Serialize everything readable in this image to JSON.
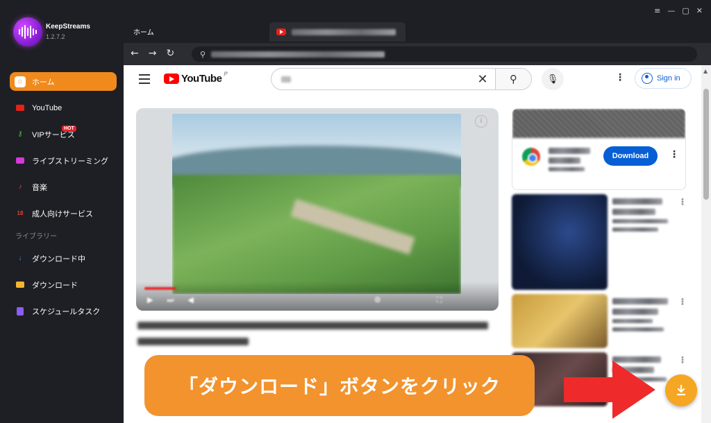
{
  "app": {
    "name": "KeepStreams",
    "version": "1.2.7.2",
    "accent_color": "#f08a1c"
  },
  "window_controls": [
    "≡",
    "—",
    "▢",
    "✕"
  ],
  "sidebar": {
    "items": [
      {
        "label": "ホーム",
        "icon": "home-icon",
        "active": true
      },
      {
        "label": "YouTube",
        "icon": "youtube-icon",
        "active": false
      },
      {
        "label": "VIPサービス",
        "icon": "key-icon",
        "badge": "HOT",
        "active": false
      },
      {
        "label": "ライブストリーミング",
        "icon": "camera-icon",
        "active": false
      },
      {
        "label": "音楽",
        "icon": "music-icon",
        "active": false
      },
      {
        "label": "成人向けサービス",
        "icon": "adult-icon",
        "active": false
      }
    ],
    "library_label": "ライブラリー",
    "library_items": [
      {
        "label": "ダウンロード中",
        "icon": "download-arrow-icon"
      },
      {
        "label": "ダウンロード",
        "icon": "folder-icon"
      },
      {
        "label": "スケジュールタスク",
        "icon": "schedule-icon"
      }
    ]
  },
  "tabs": {
    "home_label": "ホーム"
  },
  "youtube": {
    "logo_text": "YouTube",
    "logo_region": "JP",
    "signin_label": "Sign in",
    "ad_button_label": "Download"
  },
  "callout": {
    "text": "「ダウンロード」ボタンをクリック",
    "color": "#f2932e"
  },
  "arrow_color": "#ee2a2a",
  "fab_color": "#f5a623"
}
